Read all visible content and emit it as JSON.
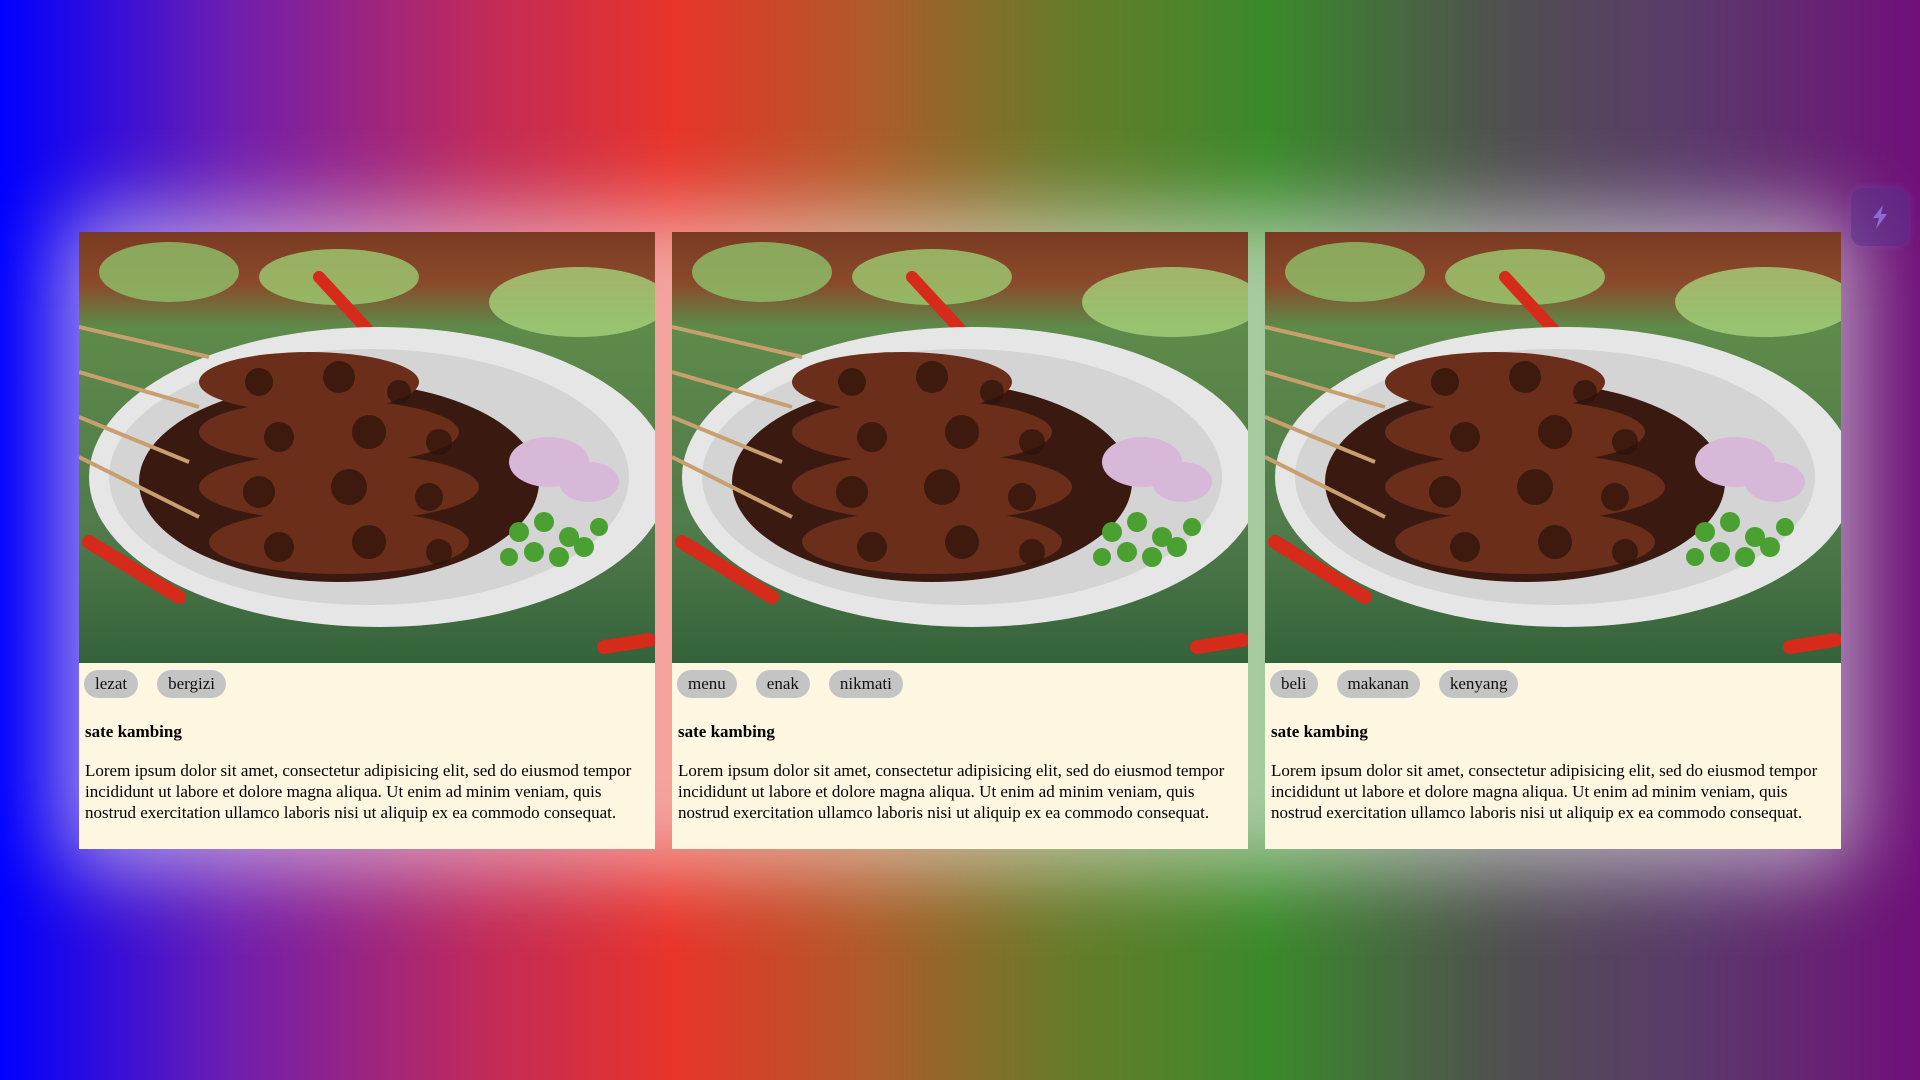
{
  "cards": [
    {
      "tags": [
        "lezat",
        "bergizi"
      ],
      "title": "sate kambing",
      "description": "Lorem ipsum dolor sit amet, consectetur adipisicing elit, sed do eiusmod tempor incididunt ut labore et dolore magna aliqua. Ut enim ad minim veniam, quis nostrud exercitation ullamco laboris nisi ut aliquip ex ea commodo consequat."
    },
    {
      "tags": [
        "menu",
        "enak",
        "nikmati"
      ],
      "title": "sate kambing",
      "description": "Lorem ipsum dolor sit amet, consectetur adipisicing elit, sed do eiusmod tempor incididunt ut labore et dolore magna aliqua. Ut enim ad minim veniam, quis nostrud exercitation ullamco laboris nisi ut aliquip ex ea commodo consequat."
    },
    {
      "tags": [
        "beli",
        "makanan",
        "kenyang"
      ],
      "title": "sate kambing",
      "description": "Lorem ipsum dolor sit amet, consectetur adipisicing elit, sed do eiusmod tempor incididunt ut labore et dolore magna aliqua. Ut enim ad minim veniam, quis nostrud exercitation ullamco laboris nisi ut aliquip ex ea commodo consequat."
    }
  ],
  "extension_icon": "lightning-extension-icon",
  "colors": {
    "card_bg": "#fdf6e0",
    "tag_bg": "#c4c4c4",
    "ext_button": "#5a328c"
  }
}
